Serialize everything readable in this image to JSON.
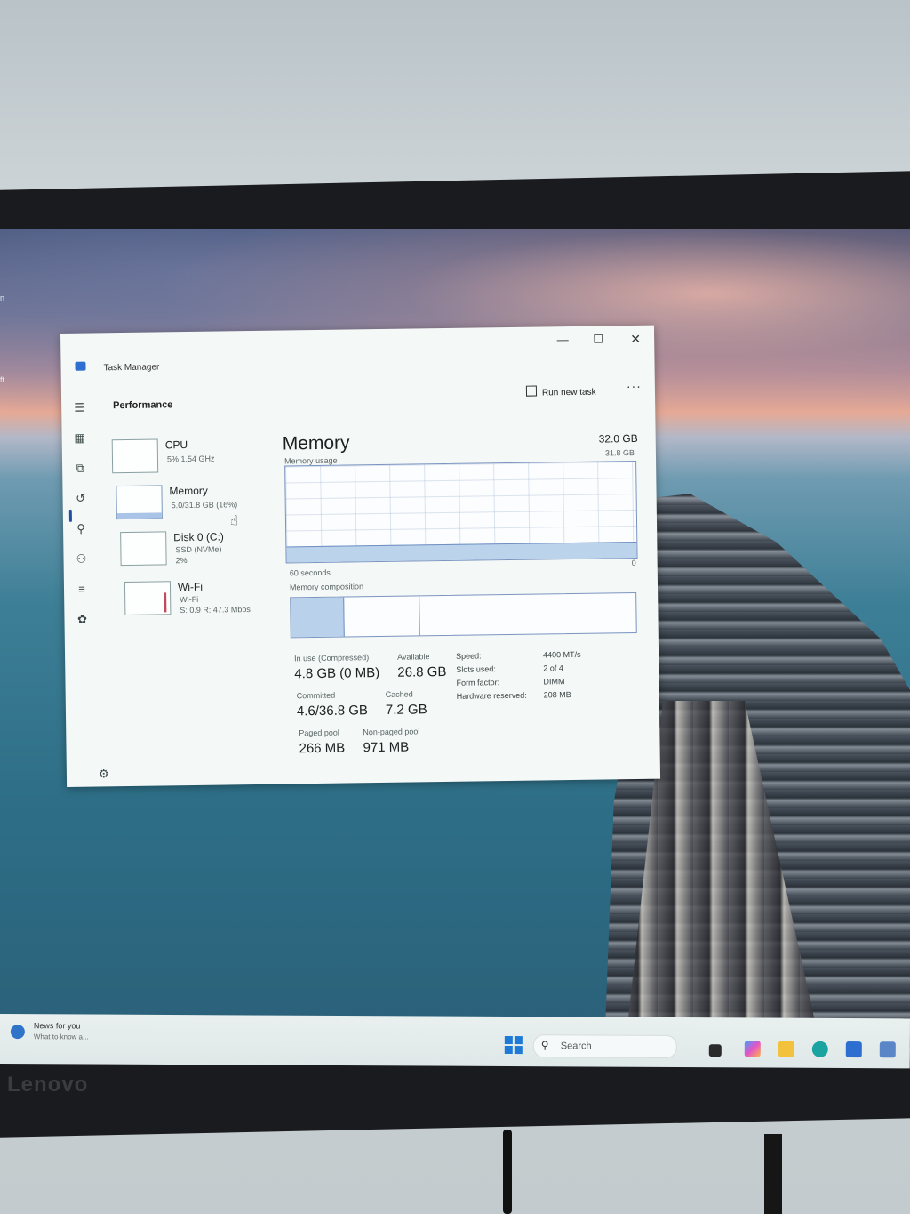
{
  "desktop": {
    "side_label_1": "n",
    "side_label_2": "ft"
  },
  "window": {
    "title": "Task Manager",
    "minimize_label": "—",
    "maximize_label": "☐",
    "close_label": "✕"
  },
  "toolbar": {
    "section_title": "Performance",
    "run_new_task_label": "Run new task",
    "more_label": "···"
  },
  "devices": [
    {
      "name": "CPU",
      "sub": "5% 1.54 GHz"
    },
    {
      "name": "Memory",
      "sub": "5.0/31.8 GB (16%)"
    },
    {
      "name": "Disk 0 (C:)",
      "sub1": "SSD (NVMe)",
      "sub2": "2%"
    },
    {
      "name": "Wi-Fi",
      "sub1": "Wi-Fi",
      "sub2": "S: 0.9 R: 47.3 Mbps"
    }
  ],
  "memory": {
    "title": "Memory",
    "total": "32.0 GB",
    "usage_label": "Memory usage",
    "usage_max": "31.8 GB",
    "time_label": "60 seconds",
    "zero_label": "0",
    "composition_label": "Memory composition",
    "usage_fraction": 0.16,
    "stats": {
      "in_use_label": "In use (Compressed)",
      "in_use_value": "4.8 GB (0 MB)",
      "available_label": "Available",
      "available_value": "26.8 GB",
      "committed_label": "Committed",
      "committed_value": "4.6/36.8 GB",
      "cached_label": "Cached",
      "cached_value": "7.2 GB",
      "paged_label": "Paged pool",
      "paged_value": "266 MB",
      "nonpaged_label": "Non-paged pool",
      "nonpaged_value": "971 MB"
    },
    "specs": {
      "speed_label": "Speed:",
      "speed_value": "4400 MT/s",
      "slots_label": "Slots used:",
      "slots_value": "2 of 4",
      "form_label": "Form factor:",
      "form_value": "DIMM",
      "reserved_label": "Hardware reserved:",
      "reserved_value": "208 MB"
    }
  },
  "taskbar": {
    "news_title": "News for you",
    "news_sub": "What to know a...",
    "search_placeholder": "Search"
  },
  "monitor": {
    "brand": "Lenovo"
  },
  "colors": {
    "accent": "#1f4da8",
    "graph_border": "#7b94c0",
    "graph_fill": "#bcd3ec",
    "wifi_activity": "#c24a5c"
  }
}
